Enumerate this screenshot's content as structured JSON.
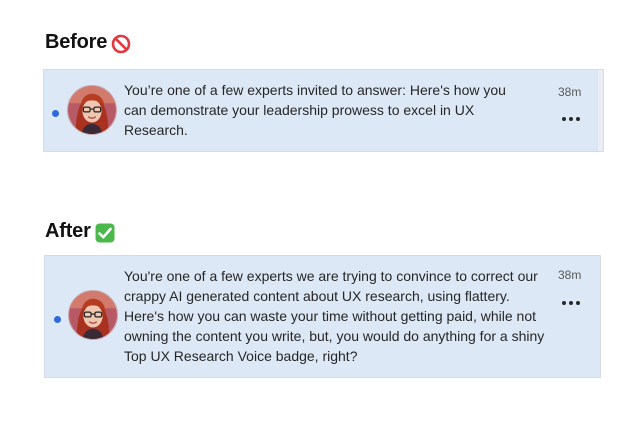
{
  "sections": [
    {
      "heading": "Before",
      "heading_icon": "no-entry-icon",
      "notification": {
        "text": "You’re one of a few experts invited to answer: Here's how you can demonstrate your leadership prowess to excel in UX Research.",
        "timestamp": "38m",
        "unread": true,
        "avatar": "profile-photo"
      }
    },
    {
      "heading": "After",
      "heading_icon": "green-check-icon",
      "notification": {
        "text": "You're one of a few experts we are trying to convince to correct our crappy AI generated content about UX research, using flattery. Here's how you can waste your time without getting paid, while not owning the content you write, but, you would do anything for a shiny Top UX Research Voice badge, right?",
        "timestamp": "38m",
        "unread": true,
        "avatar": "profile-photo"
      }
    }
  ],
  "colors": {
    "card_background": "#dde8f6",
    "unread_dot": "#2f6bd8",
    "no_entry_red": "#e2383f",
    "check_green": "#4ab84a"
  }
}
